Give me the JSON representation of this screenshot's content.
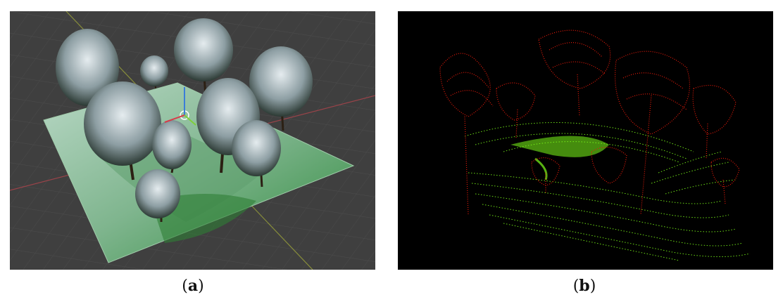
{
  "figure": {
    "panel_a": {
      "label": "a",
      "colors": {
        "background": "#3f3f3f",
        "terrain": "#4f9a5e",
        "foliage": "#9fb0b5"
      }
    },
    "panel_b": {
      "label": "b",
      "colors": {
        "background": "#000000",
        "trees": "#e41a0a",
        "ground": "#7dff1a"
      }
    }
  }
}
